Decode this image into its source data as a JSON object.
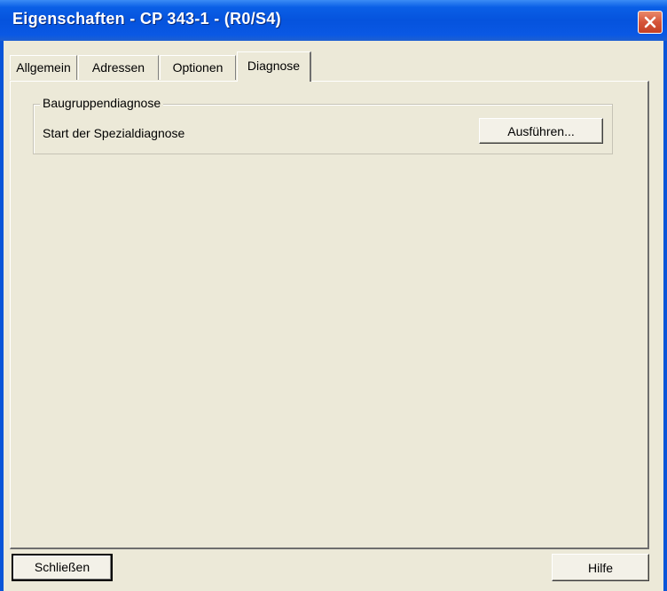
{
  "window": {
    "title": "Eigenschaften - CP 343-1 - (R0/S4)",
    "close_icon": "close-icon",
    "accent_color": "#0553dd",
    "close_color": "#d5553a"
  },
  "tabs": [
    {
      "label": "Allgemein",
      "active": false
    },
    {
      "label": "Adressen",
      "active": false
    },
    {
      "label": "Optionen",
      "active": false
    },
    {
      "label": "Diagnose",
      "active": true
    }
  ],
  "group": {
    "label": "Baugruppendiagnose",
    "row_text": "Start der Spezialdiagnose",
    "run_button": "Ausführen..."
  },
  "footer": {
    "close_button": "Schließen",
    "help_button": "Hilfe"
  }
}
